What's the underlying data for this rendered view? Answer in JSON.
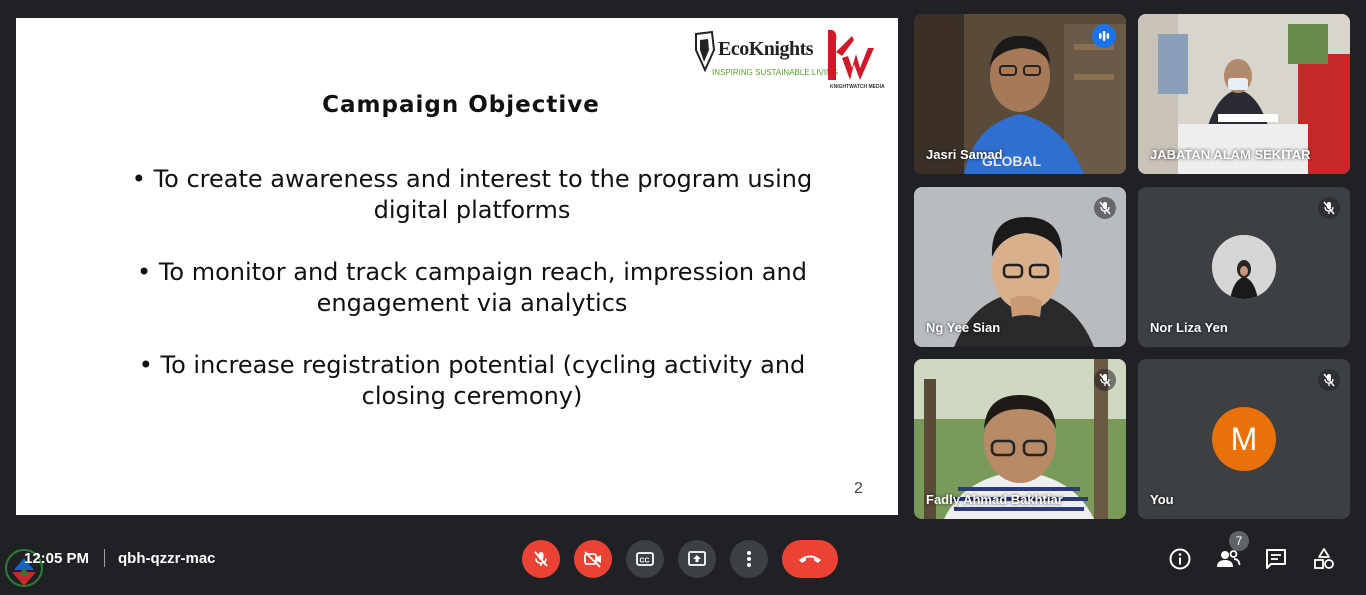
{
  "slide": {
    "title": "Campaign Objective",
    "bullets": [
      "• To create awareness and interest to the program using digital platforms",
      "• To monitor and track campaign reach, impression and engagement via analytics",
      "• To increase registration potential (cycling activity and closing ceremony)"
    ],
    "page_number": "2",
    "logo_primary": "EcoKnights",
    "logo_tagline": "INSPIRING SUSTAINABLE LIVING",
    "logo_secondary": "KNIGHTWATCH MEDIA"
  },
  "participants": [
    {
      "name": "Jasri Samad",
      "state": "speaking"
    },
    {
      "name": "JABATAN ALAM SEKITAR",
      "state": "camera-on"
    },
    {
      "name": "Ng Yee Sian",
      "state": "muted"
    },
    {
      "name": "Nor Liza Yen",
      "state": "muted"
    },
    {
      "name": "Fadly Ahmad Bakhtiar",
      "state": "muted"
    },
    {
      "name": "You",
      "state": "muted",
      "avatar_letter": "M"
    }
  ],
  "bottom_bar": {
    "time": "12:05 PM",
    "separator": "|",
    "meeting_code": "qbh-qzzr-mac",
    "participant_count": "7"
  },
  "controls": {
    "mic": "mic-off-icon",
    "camera": "camera-off-icon",
    "captions": "captions-icon",
    "present": "present-icon",
    "more": "more-vert-icon",
    "leave": "end-call-icon"
  },
  "colors": {
    "background": "#202124",
    "tile": "#3c4043",
    "danger": "#ea4335",
    "active_border": "#8ab4f8",
    "speaking": "#1a73e8",
    "avatar_orange": "#e8710a"
  }
}
